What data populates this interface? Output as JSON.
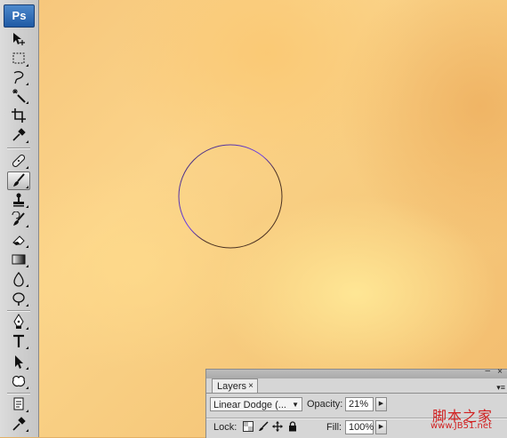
{
  "app": {
    "logo": "Ps"
  },
  "toolbar": {
    "tools": [
      {
        "icon": "move-tool-icon"
      },
      {
        "icon": "marquee-tool-icon"
      },
      {
        "icon": "lasso-tool-icon"
      },
      {
        "icon": "magic-wand-tool-icon"
      },
      {
        "icon": "crop-tool-icon"
      },
      {
        "icon": "eyedropper-tool-icon"
      },
      {
        "icon": "healing-brush-tool-icon"
      },
      {
        "icon": "brush-tool-icon",
        "active": true
      },
      {
        "icon": "clone-stamp-tool-icon"
      },
      {
        "icon": "history-brush-tool-icon"
      },
      {
        "icon": "eraser-tool-icon"
      },
      {
        "icon": "gradient-tool-icon"
      },
      {
        "icon": "blur-tool-icon"
      },
      {
        "icon": "dodge-tool-icon"
      },
      {
        "icon": "pen-tool-icon"
      },
      {
        "icon": "type-tool-icon"
      },
      {
        "icon": "path-selection-tool-icon"
      },
      {
        "icon": "custom-shape-tool-icon"
      },
      {
        "icon": "notes-tool-icon"
      },
      {
        "icon": "eyedropper-tool-icon-2"
      }
    ]
  },
  "layers_panel": {
    "tab_label": "Layers",
    "tab_close": "×",
    "minimize": "–",
    "close": "×",
    "menu": "▾≡",
    "blend_mode": "Linear Dodge (...",
    "opacity_label": "Opacity:",
    "opacity_value": "21%",
    "lock_label": "Lock:",
    "fill_label": "Fill:",
    "fill_value": "100%"
  },
  "watermark": {
    "text": "脚本之家",
    "url": "www.JB51.net"
  }
}
